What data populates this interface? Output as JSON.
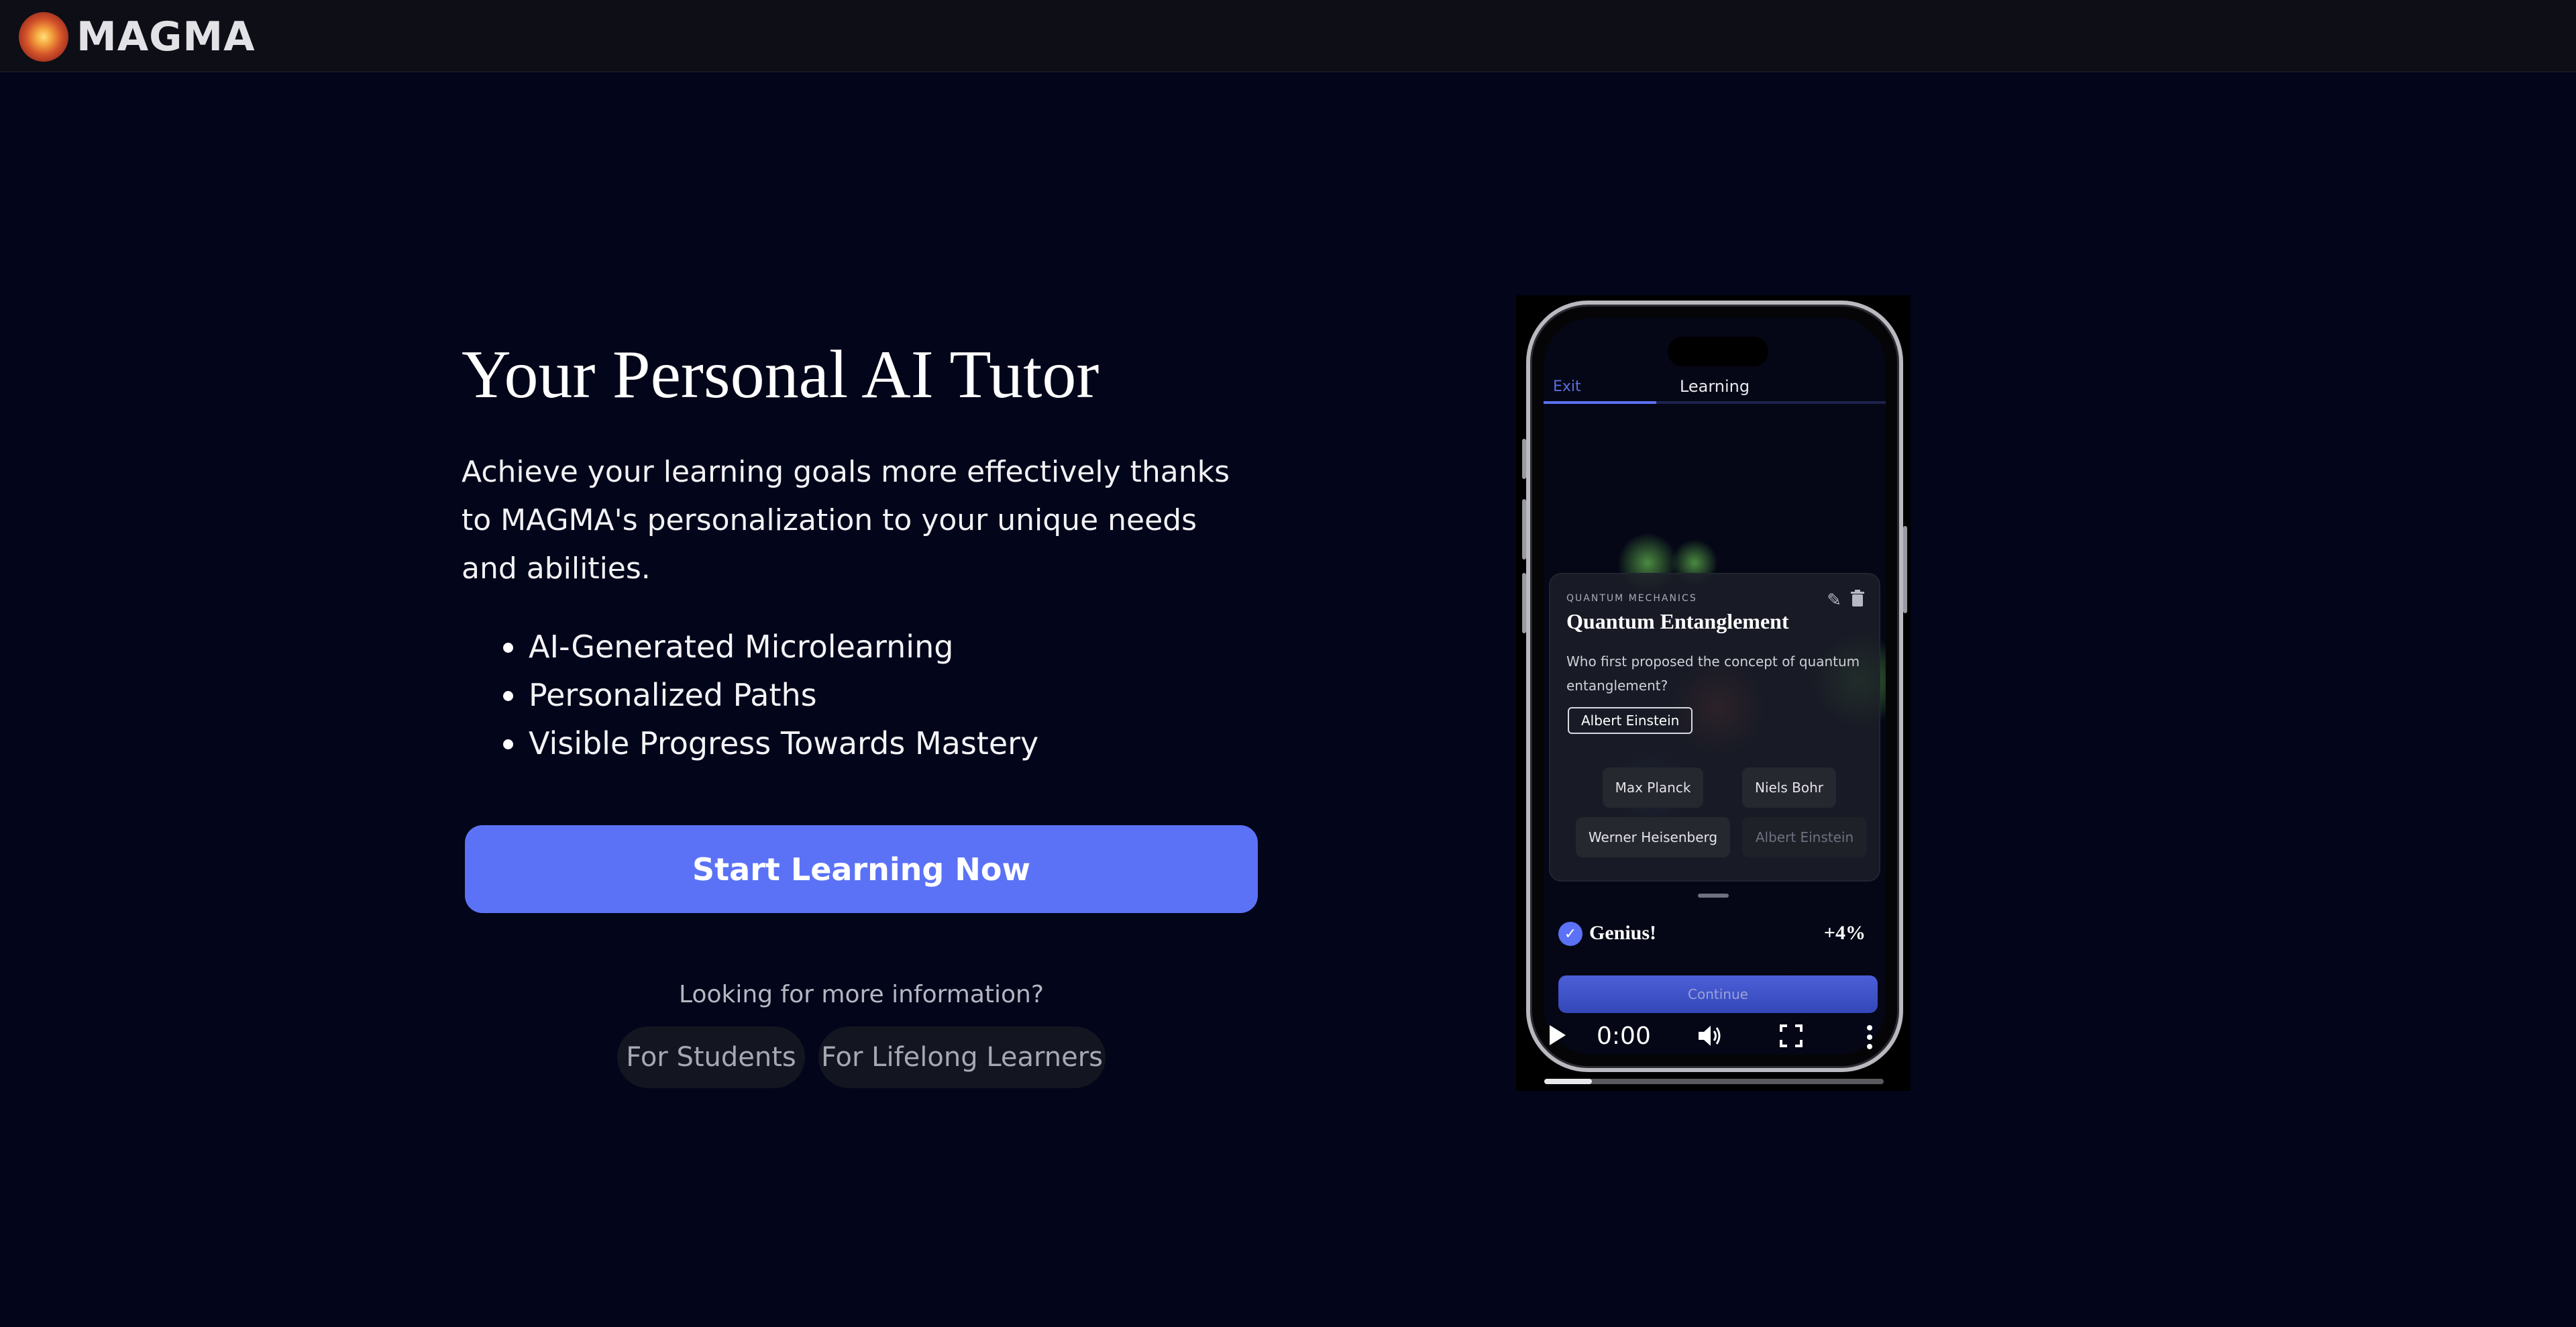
{
  "header": {
    "brand": "MAGMA"
  },
  "hero": {
    "title": "Your Personal AI Tutor",
    "description": "Achieve your learning goals more effectively thanks to MAGMA's personalization to your unique needs and abilities.",
    "features": [
      "AI-Generated Microlearning",
      "Personalized Paths",
      "Visible Progress Towards Mastery"
    ],
    "cta_label": "Start Learning Now",
    "more_info": "Looking for more information?",
    "links": [
      "For Students",
      "For Lifelong Learners"
    ]
  },
  "app_preview": {
    "exit_label": "Exit",
    "screen_title": "Learning",
    "progress": 0.33,
    "card": {
      "category": "QUANTUM MECHANICS",
      "title": "Quantum Entanglement",
      "question": "Who first proposed the concept of quantum entanglement?",
      "answer": "Albert Einstein",
      "options": [
        "Max Planck",
        "Niels Bohr",
        "Werner Heisenberg",
        "Albert Einstein"
      ]
    },
    "feedback": {
      "label": "Genius!",
      "gain": "+4%"
    },
    "continue_label": "Continue"
  },
  "video": {
    "time": "0:00",
    "played": 0.14
  },
  "colors": {
    "accent": "#5b72f6",
    "background": "#03051a",
    "topbar": "#0d0e16"
  }
}
